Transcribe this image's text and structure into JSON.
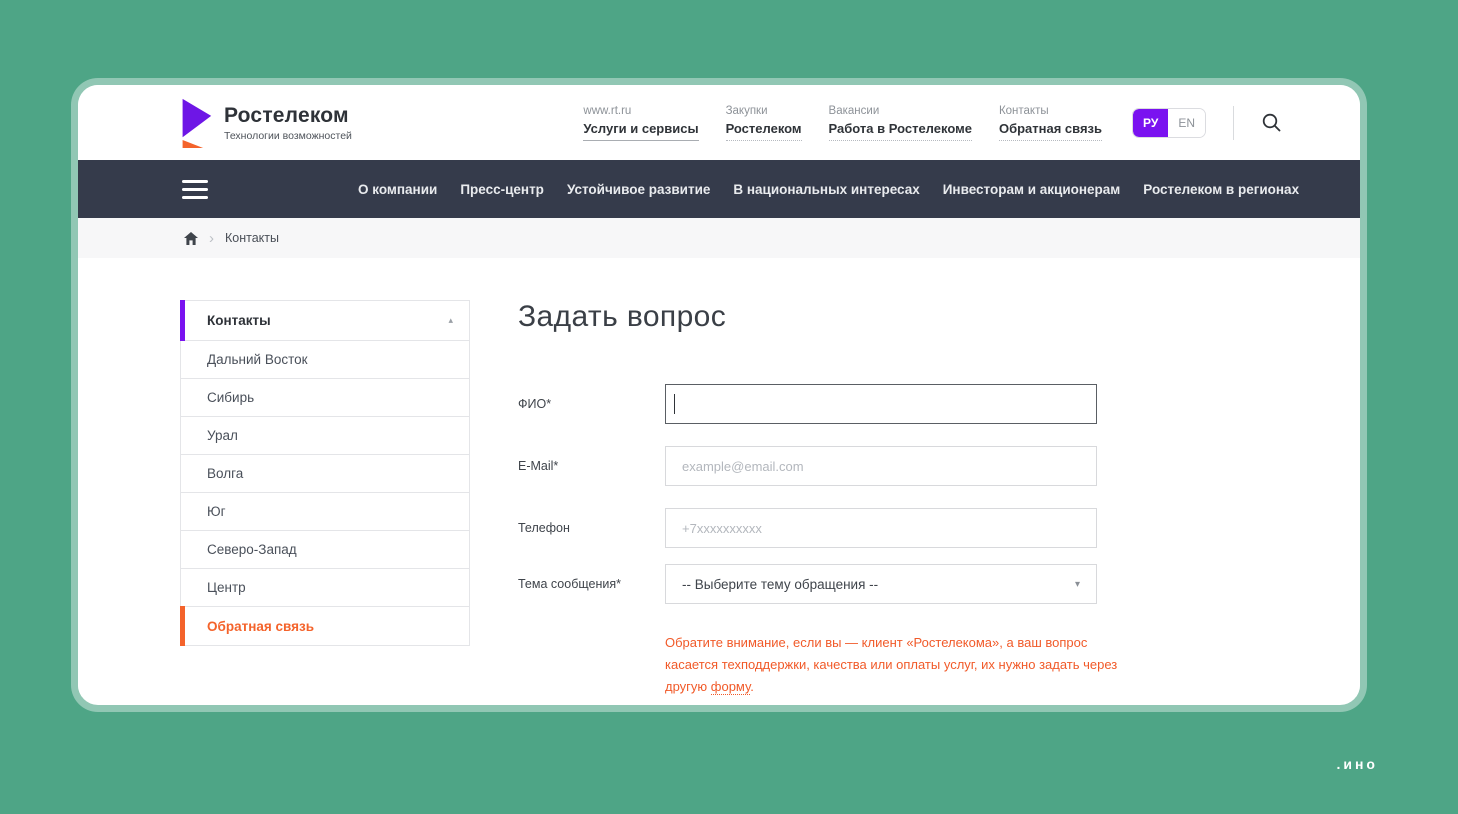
{
  "page": {
    "watermark": ".ино"
  },
  "colors": {
    "background_green": "#4EA586",
    "nav_bar_dark": "#353B4B",
    "accent_purple": "#7A12F0",
    "accent_orange": "#F4632B",
    "notice_orange": "#F15A29"
  },
  "icons": {
    "caret_up": "▴",
    "caret_down": "▾",
    "breadcrumb_separator": "›",
    "search": "magnifier-glyph",
    "menu": "hamburger-bars",
    "home": "house-glyph"
  },
  "header": {
    "logo": {
      "name": "Ростелеком",
      "tagline": "Технологии возможностей"
    },
    "links": [
      {
        "top": "www.rt.ru",
        "bottom": "Услуги и сервисы"
      },
      {
        "top": "Закупки",
        "bottom": "Ростелеком"
      },
      {
        "top": "Вакансии",
        "bottom": "Работа в Ростелекоме"
      },
      {
        "top": "Контакты",
        "bottom": "Обратная связь"
      }
    ],
    "lang": {
      "active": "РУ",
      "inactive": "EN"
    }
  },
  "nav": {
    "items": [
      "О компании",
      "Пресс-центр",
      "Устойчивое развитие",
      "В национальных интересах",
      "Инвесторам и акционерам",
      "Ростелеком в регионах"
    ]
  },
  "breadcrumb": {
    "current": "Контакты"
  },
  "sidebar": {
    "header": "Контакты",
    "items": [
      "Дальний Восток",
      "Сибирь",
      "Урал",
      "Волга",
      "Юг",
      "Северо-Запад",
      "Центр"
    ],
    "active_item": "Обратная связь"
  },
  "form": {
    "title": "Задать вопрос",
    "fio": {
      "label": "ФИО*",
      "value": ""
    },
    "email": {
      "label": "E-Mail*",
      "placeholder": "example@email.com"
    },
    "phone": {
      "label": "Телефон",
      "placeholder": "+7xxxxxxxxxx"
    },
    "topic": {
      "label": "Тема сообщения*",
      "value": "-- Выберите тему обращения --"
    },
    "notice": {
      "text_before": "Обратите внимание, если вы — клиент «Ростелекома», а ваш вопрос касается техподдержки, качества или оплаты услуг, их нужно задать через другую ",
      "link": "форму",
      "text_after": "."
    }
  }
}
